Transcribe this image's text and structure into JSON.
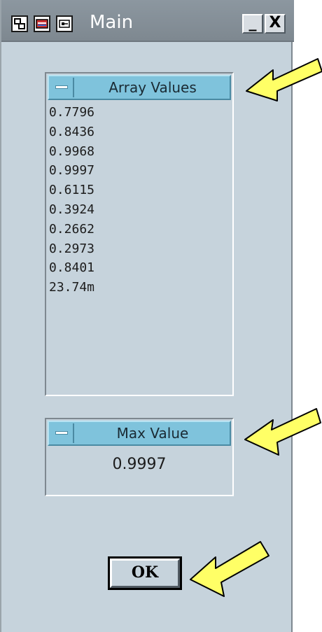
{
  "window": {
    "title": "Main",
    "minimize_label": "_",
    "close_label": "X"
  },
  "array_panel": {
    "title": "Array Values",
    "values": [
      "0.7796",
      "0.8436",
      "0.9968",
      "0.9997",
      "0.6115",
      "0.3924",
      "0.2662",
      "0.2973",
      "0.8401",
      "23.74m"
    ]
  },
  "max_panel": {
    "title": "Max Value",
    "value": "0.9997"
  },
  "ok_button": {
    "label": "OK"
  },
  "colors": {
    "panel_header": "#7fc3dc",
    "window_bg": "#c6d3dc",
    "arrow": "#ffff66"
  }
}
